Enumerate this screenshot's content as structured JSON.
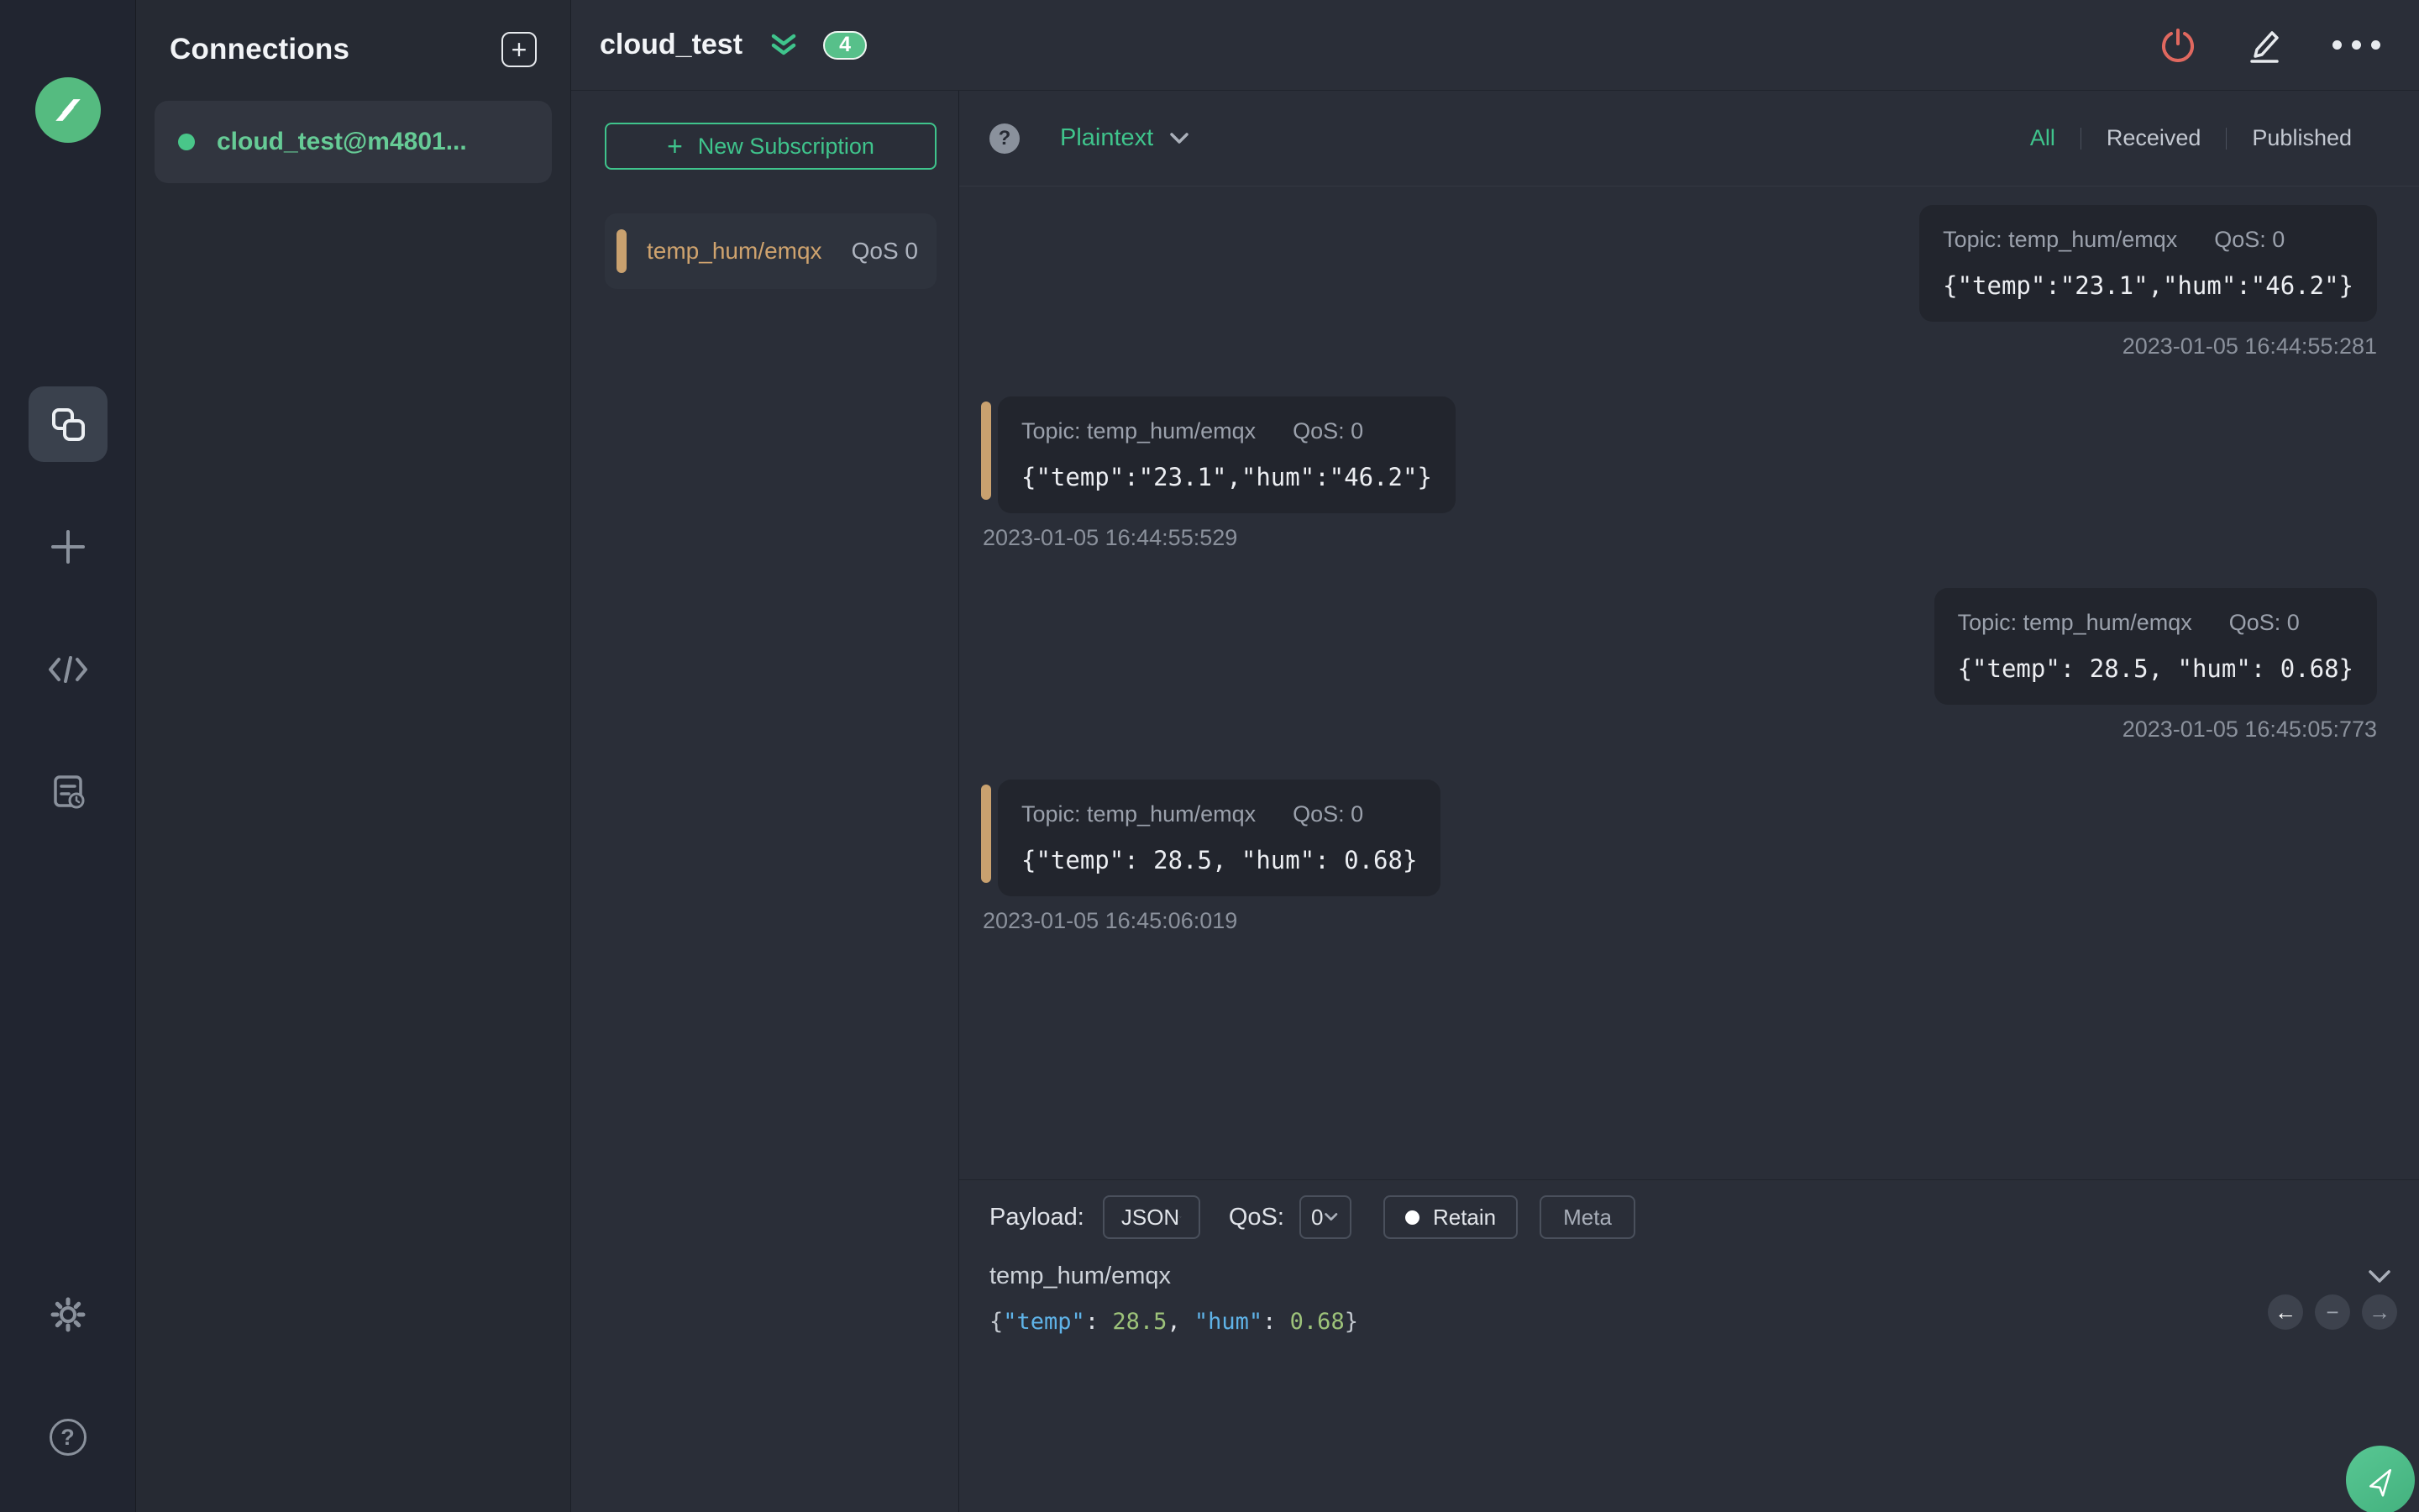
{
  "icons": {
    "plus": "+",
    "question_mark": "?",
    "arrow_left": "←",
    "minus": "−",
    "arrow_right": "→"
  },
  "connections": {
    "title": "Connections",
    "items": [
      {
        "name": "cloud_test@m4801...",
        "status_color": "#49c689"
      }
    ]
  },
  "header": {
    "title": "cloud_test",
    "badge": "4"
  },
  "subscriptions": {
    "new_button_label": "New Subscription",
    "items": [
      {
        "topic": "temp_hum/emqx",
        "qos": "QoS 0",
        "accent_color": "#c9a16f"
      }
    ]
  },
  "messages": {
    "format_selected": "Plaintext",
    "tabs": {
      "all": "All",
      "received": "Received",
      "published": "Published"
    },
    "active_tab": "All",
    "list": [
      {
        "direction": "published",
        "topic_line": "Topic: temp_hum/emqx",
        "qos_line": "QoS: 0",
        "payload": "{\"temp\":\"23.1\",\"hum\":\"46.2\"}",
        "time": "2023-01-05 16:44:55:281"
      },
      {
        "direction": "received",
        "topic_line": "Topic: temp_hum/emqx",
        "qos_line": "QoS: 0",
        "payload": "{\"temp\":\"23.1\",\"hum\":\"46.2\"}",
        "time": "2023-01-05 16:44:55:529"
      },
      {
        "direction": "published",
        "topic_line": "Topic: temp_hum/emqx",
        "qos_line": "QoS: 0",
        "payload": "{\"temp\": 28.5, \"hum\": 0.68}",
        "time": "2023-01-05 16:45:05:773"
      },
      {
        "direction": "received",
        "topic_line": "Topic: temp_hum/emqx",
        "qos_line": "QoS: 0",
        "payload": "{\"temp\": 28.5, \"hum\": 0.68}",
        "time": "2023-01-05 16:45:06:019"
      }
    ]
  },
  "publish": {
    "payload_label": "Payload:",
    "payload_format": "JSON",
    "qos_label": "QoS:",
    "qos_value": "0",
    "retain_label": "Retain",
    "meta_label": "Meta",
    "topic": "temp_hum/emqx",
    "payload_tokens": {
      "open": "{",
      "key1": "\"temp\"",
      "sep1": ": ",
      "val1": "28.5",
      "comma": ", ",
      "key2": "\"hum\"",
      "sep2": ": ",
      "val2": "0.68",
      "close": "}"
    }
  },
  "colors": {
    "accent_green": "#3fc48c",
    "badge_green": "#57c08a",
    "connection_green": "#66cb96",
    "topic_tan": "#cfa36e",
    "power_red": "#e0685f",
    "syntax_key_blue": "#5fb3e8",
    "syntax_num_green": "#9dc37a"
  }
}
